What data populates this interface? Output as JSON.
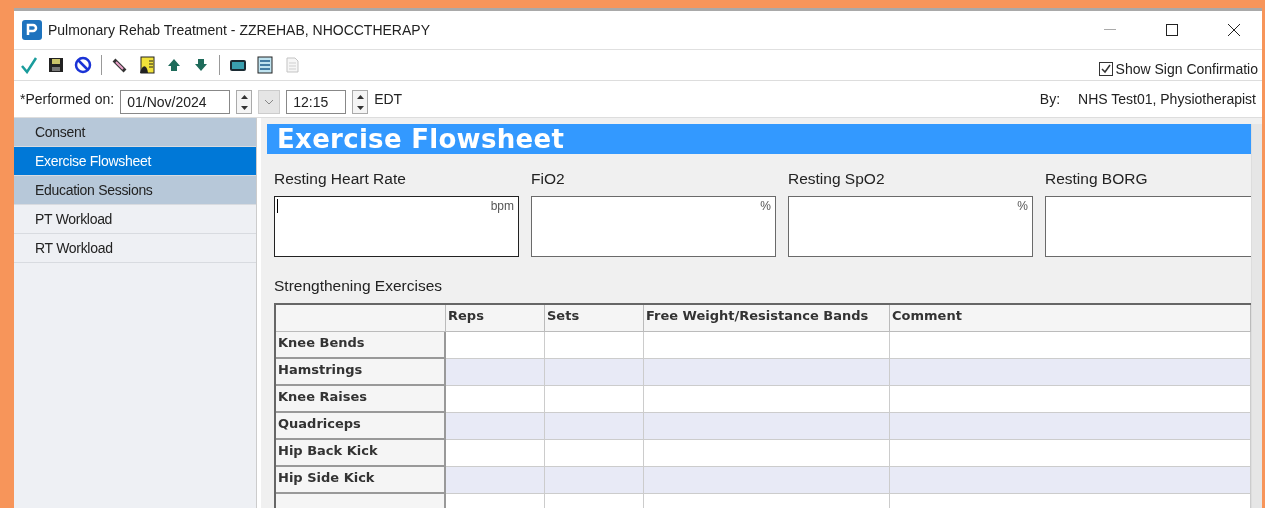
{
  "window": {
    "title": "Pulmonary Rehab Treatment - ZZREHAB, NHOCCTHERAPY"
  },
  "toolbar": {
    "buttons": [
      {
        "kind": "sign",
        "disabled": false
      },
      {
        "kind": "save",
        "disabled": false
      },
      {
        "kind": "cancel",
        "disabled": false
      },
      {
        "kind": "divider"
      },
      {
        "kind": "pen",
        "disabled": false
      },
      {
        "kind": "note",
        "disabled": false
      },
      {
        "kind": "up",
        "disabled": false
      },
      {
        "kind": "down",
        "disabled": false
      },
      {
        "kind": "divider"
      },
      {
        "kind": "keyboard",
        "disabled": false
      },
      {
        "kind": "checklist",
        "disabled": false
      },
      {
        "kind": "document",
        "disabled": true
      }
    ],
    "show_sign_confirmation": {
      "label": "Show Sign Confirmatio",
      "checked": true
    }
  },
  "performed": {
    "label": "*Performed on:",
    "date": "01/Nov/2024",
    "time": "12:15",
    "timezone": "EDT",
    "by_label": "By:",
    "by_value": "NHS Test01, Physiotherapist"
  },
  "sidebar": {
    "items": [
      {
        "label": "Consent",
        "selected": false,
        "completed": true
      },
      {
        "label": "Exercise Flowsheet",
        "selected": true,
        "completed": true
      },
      {
        "label": "Education Sessions",
        "selected": false,
        "completed": true
      },
      {
        "label": "PT Workload",
        "selected": false,
        "completed": false
      },
      {
        "label": "RT Workload",
        "selected": false,
        "completed": false
      }
    ]
  },
  "form": {
    "title": "Exercise Flowsheet",
    "vitals": [
      {
        "label": "Resting Heart Rate",
        "unit": "bpm",
        "focused": true
      },
      {
        "label": "FiO2",
        "unit": "%",
        "focused": false
      },
      {
        "label": "Resting SpO2",
        "unit": "%",
        "focused": false
      },
      {
        "label": "Resting BORG",
        "focused": false
      }
    ],
    "section_title": "Strengthening Exercises",
    "table": {
      "columns": [
        "Reps",
        "Sets",
        "Free Weight/Resistance Bands",
        "Comment"
      ],
      "rows": [
        {
          "label": "Knee Bends"
        },
        {
          "label": "Hamstrings"
        },
        {
          "label": "Knee Raises"
        },
        {
          "label": "Quadriceps"
        },
        {
          "label": "Hip Back Kick"
        },
        {
          "label": "Hip Side Kick"
        }
      ]
    }
  }
}
